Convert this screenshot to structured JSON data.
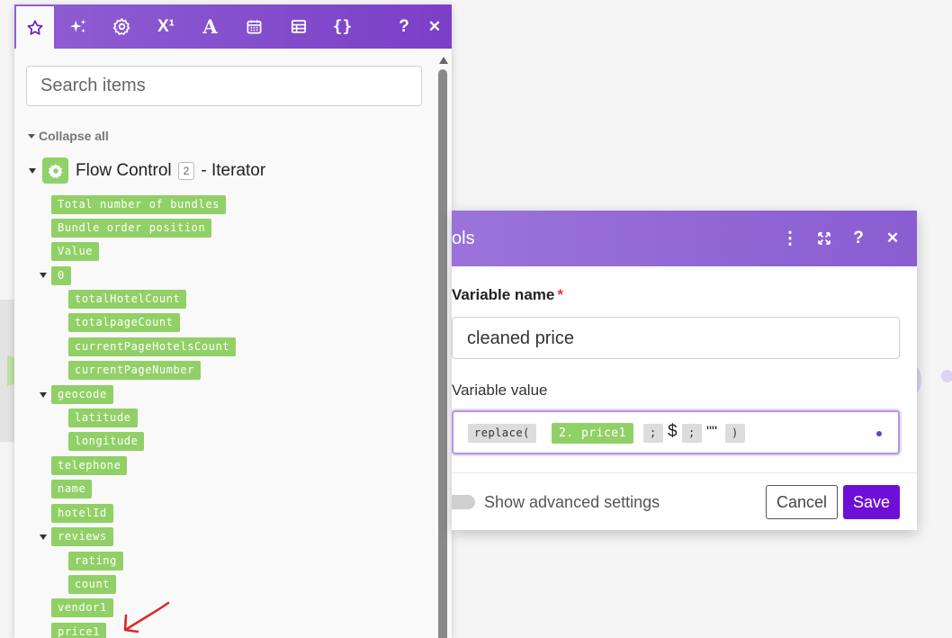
{
  "toolbar": {
    "tabs": [
      {
        "name": "favorites-tab",
        "icon": "star-icon",
        "active": true
      },
      {
        "name": "ai-tab",
        "icon": "sparkles-icon"
      },
      {
        "name": "general-functions-tab",
        "icon": "gear-icon"
      },
      {
        "name": "math-functions-tab",
        "icon": "superscript-icon",
        "glyph": "X¹"
      },
      {
        "name": "text-functions-tab",
        "icon": "text-a-icon",
        "glyph": "A"
      },
      {
        "name": "date-functions-tab",
        "icon": "calendar-icon"
      },
      {
        "name": "array-functions-tab",
        "icon": "table-icon"
      },
      {
        "name": "json-tab",
        "icon": "braces-icon",
        "glyph": "{}"
      }
    ],
    "help_glyph": "?",
    "close_glyph": "✕"
  },
  "search": {
    "placeholder": "Search items"
  },
  "tree": {
    "collapse_all": "Collapse all",
    "module": {
      "title": "Flow Control",
      "number": "2",
      "subtitle": "- Iterator",
      "icon": "gear-icon"
    },
    "items": [
      {
        "label": "Total number of bundles"
      },
      {
        "label": "Bundle order position"
      },
      {
        "label": "Value"
      },
      {
        "label": "0"
      },
      {
        "label": "totalHotelCount"
      },
      {
        "label": "totalpageCount"
      },
      {
        "label": "currentPageHotelsCount"
      },
      {
        "label": "currentPageNumber"
      },
      {
        "label": "geocode"
      },
      {
        "label": "latitude"
      },
      {
        "label": "longitude"
      },
      {
        "label": "telephone"
      },
      {
        "label": "name"
      },
      {
        "label": "hotelId"
      },
      {
        "label": "reviews"
      },
      {
        "label": "rating"
      },
      {
        "label": "count"
      },
      {
        "label": "vendor1"
      },
      {
        "label": "price1"
      }
    ]
  },
  "dialog": {
    "title_fragment": "ols",
    "header_icons": [
      {
        "name": "more-options-icon",
        "glyph": "⋮"
      },
      {
        "name": "expand-icon",
        "glyph": "⤢"
      },
      {
        "name": "help-icon",
        "glyph": "?"
      },
      {
        "name": "close-icon",
        "glyph": "✕"
      }
    ],
    "variable_name_label": "Variable name",
    "required_marker": "*",
    "variable_name_value": "cleaned price",
    "variable_value_label": "Variable value",
    "expression": {
      "fn_open": "replace(",
      "mapped": "2. price1",
      "sep1": ";",
      "literal": "$",
      "sep2": ";",
      "empty": "\"\"",
      "close": ")"
    },
    "advanced_label": "Show advanced settings",
    "cancel_label": "Cancel",
    "save_label": "Save"
  },
  "colors": {
    "toolbar": "#7b3fc7",
    "pill_green": "#91d066",
    "save_button": "#6d0fd6",
    "annotation_arrow": "#d92a2a"
  }
}
